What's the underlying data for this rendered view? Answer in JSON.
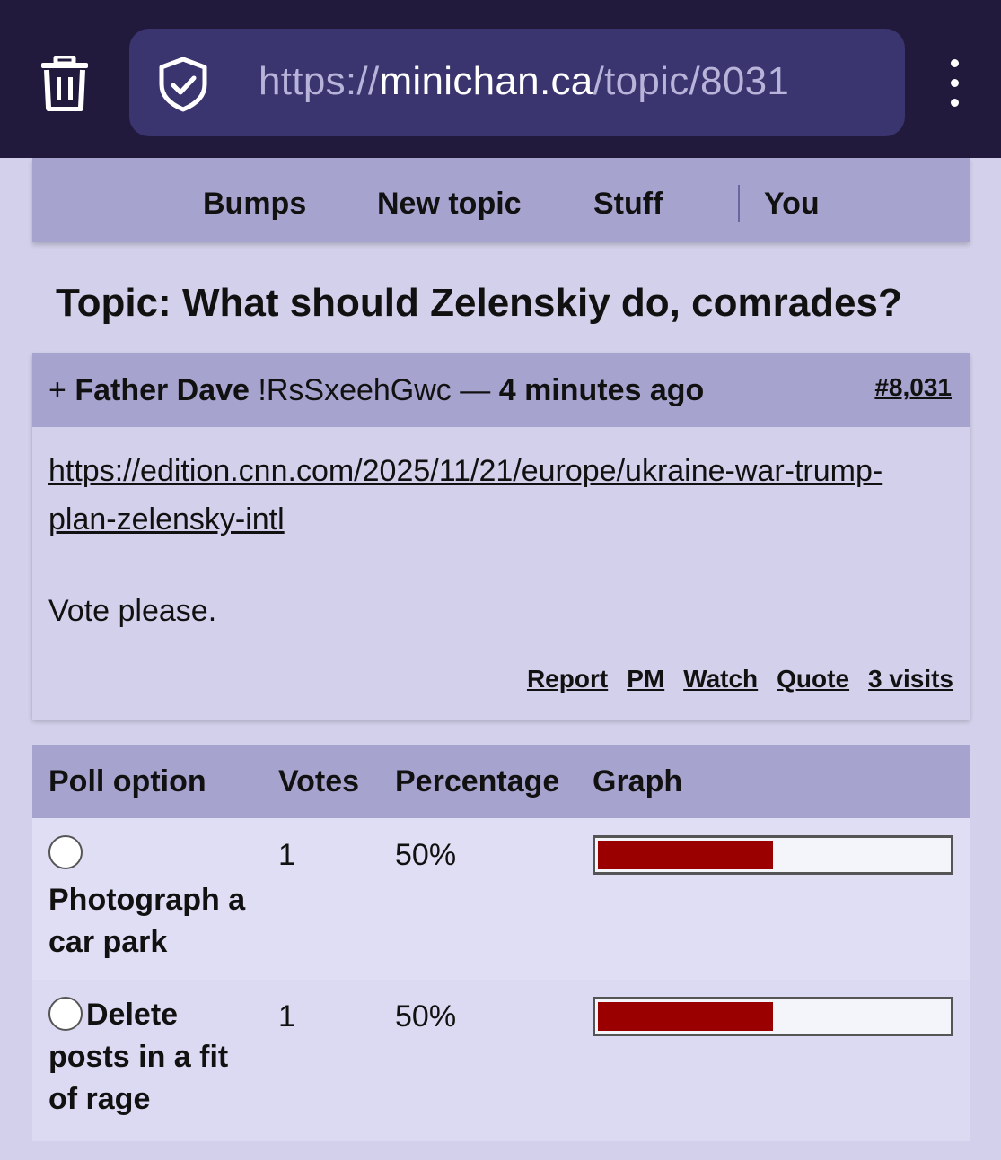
{
  "browser": {
    "url_prefix": "https://",
    "url_host": "minichan.ca",
    "url_path": "/topic/8031",
    "trash_icon": "trash-icon",
    "shield_icon": "shield-check-icon",
    "menu_icon": "kebab-menu-icon"
  },
  "nav": {
    "items": [
      "Bumps",
      "New topic",
      "Stuff",
      "You"
    ]
  },
  "topic": {
    "title": "Topic: What should Zelenskiy do, comrades?"
  },
  "post": {
    "prefix": "+ ",
    "author": "Father Dave",
    "tripcode": " !RsSxeehGwc",
    "dash": " — ",
    "time": "4 minutes ago",
    "number": "#8,031",
    "link_text": "https://edition.cnn.com/2025/11/21/europe/ukraine-war-trump-plan-zelensky-intl",
    "body": "Vote please.",
    "actions": [
      "Report",
      "PM",
      "Watch",
      "Quote",
      "3 visits"
    ]
  },
  "poll": {
    "headers": [
      "Poll option",
      "Votes",
      "Percentage",
      "Graph"
    ],
    "bar_color": "#9a0000",
    "options": [
      {
        "label": "Photograph a car park",
        "votes": "1",
        "percent": "50%",
        "fraction": 0.5
      },
      {
        "label": "Delete posts in a fit of rage",
        "votes": "1",
        "percent": "50%",
        "fraction": 0.5
      }
    ]
  }
}
